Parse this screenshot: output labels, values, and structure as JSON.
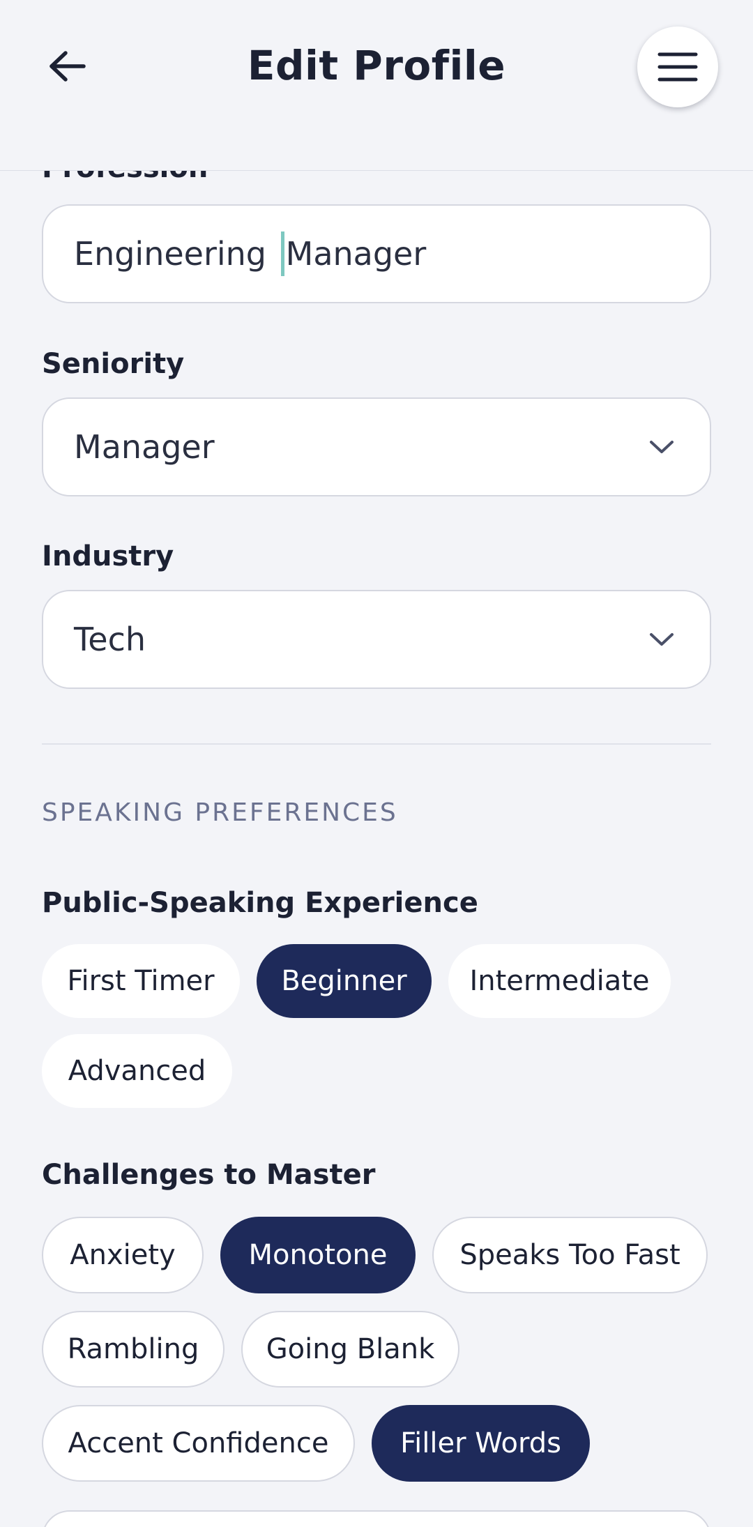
{
  "header": {
    "title": "Edit Profile",
    "back_icon": "arrow-left-icon",
    "menu_icon": "hamburger-menu-icon"
  },
  "profession": {
    "label_partial": "Profession",
    "value_before_caret": "Engineering ",
    "value_after_caret": "Manager"
  },
  "seniority": {
    "label": "Seniority",
    "value": "Manager"
  },
  "industry": {
    "label": "Industry",
    "value": "Tech"
  },
  "speaking_preferences": {
    "section_title": "SPEAKING PREFERENCES",
    "experience": {
      "label": "Public-Speaking Experience",
      "options": [
        {
          "label": "First Timer",
          "selected": false
        },
        {
          "label": "Beginner",
          "selected": true
        },
        {
          "label": "Intermediate",
          "selected": false
        },
        {
          "label": "Advanced",
          "selected": false
        }
      ]
    },
    "challenges": {
      "label": "Challenges to Master",
      "options": [
        {
          "label": "Anxiety",
          "selected": false
        },
        {
          "label": "Monotone",
          "selected": true
        },
        {
          "label": "Speaks Too Fast",
          "selected": false
        },
        {
          "label": "Rambling",
          "selected": false
        },
        {
          "label": "Going Blank",
          "selected": false
        },
        {
          "label": "Accent Confidence",
          "selected": false
        },
        {
          "label": "Filler Words",
          "selected": true
        }
      ]
    }
  },
  "colors": {
    "background": "#f3f4f8",
    "selected_chip": "#1e2a5a",
    "caret": "#7ec8c0",
    "section_title": "#6b7290"
  }
}
